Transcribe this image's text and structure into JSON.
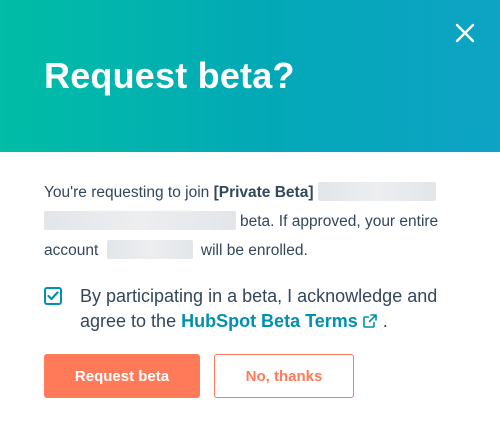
{
  "dialog": {
    "title": "Request beta?",
    "close_icon": "close-icon"
  },
  "body": {
    "intro": "You're requesting to join ",
    "beta_name": "[Private Beta]",
    "middle": "beta. If approved, your entire",
    "account_prefix": "account ",
    "account_suffix": " will be enrolled."
  },
  "consent": {
    "checked": true,
    "text_before_link": "By participating in a beta, I acknowledge and agree to the ",
    "link_label": "HubSpot Beta Terms",
    "link_icon": "external-link-icon",
    "text_after_link": " ."
  },
  "actions": {
    "primary_label": "Request beta",
    "secondary_label": "No, thanks"
  },
  "colors": {
    "header_gradient_start": "#00bda5",
    "header_gradient_end": "#0ea3c5",
    "primary": "#ff7a59",
    "link": "#0091ae",
    "text": "#33475b"
  }
}
